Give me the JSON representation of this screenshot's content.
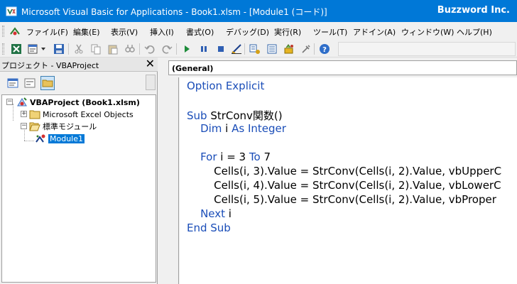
{
  "window": {
    "title": "Microsoft Visual Basic for Applications - Book1.xlsm - [Module1 (コード)]",
    "brand": "Buzzword Inc."
  },
  "menu": {
    "items": [
      {
        "label": "ファイル(F)"
      },
      {
        "label": "編集(E)"
      },
      {
        "label": "表示(V)"
      },
      {
        "label": "挿入(I)"
      },
      {
        "label": "書式(O)"
      },
      {
        "label": "デバッグ(D)"
      },
      {
        "label": "実行(R)"
      },
      {
        "label": "ツール(T)"
      },
      {
        "label": "アドイン(A)"
      },
      {
        "label": "ウィンドウ(W)"
      },
      {
        "label": "ヘルプ(H)"
      }
    ]
  },
  "toolbar": {
    "icons": [
      "excel-icon",
      "insert-userform-icon",
      "save-icon",
      "cut-icon",
      "copy-icon",
      "paste-icon",
      "find-icon",
      "undo-icon",
      "redo-icon",
      "run-icon",
      "break-icon",
      "reset-icon",
      "design-mode-icon",
      "project-explorer-icon",
      "properties-icon",
      "object-browser-icon",
      "toolbox-icon",
      "help-icon"
    ]
  },
  "project": {
    "title": "プロジェクト - VBAProject",
    "close": "✕",
    "tree": {
      "project": "VBAProject (Book1.xlsm)",
      "excel_objects": "Microsoft Excel Objects",
      "standard_modules": "標準モジュール",
      "module": "Module1"
    }
  },
  "code": {
    "procedure_dropdown": "(General)",
    "lines": [
      {
        "segments": [
          {
            "text": "Option Explicit",
            "kw": true
          }
        ]
      },
      {
        "segments": []
      },
      {
        "segments": [
          {
            "text": "Sub ",
            "kw": true
          },
          {
            "text": "StrConv関数()",
            "kw": false
          }
        ]
      },
      {
        "segments": [
          {
            "text": "    Dim ",
            "kw": true
          },
          {
            "text": "i ",
            "kw": false
          },
          {
            "text": "As Integer",
            "kw": true
          }
        ]
      },
      {
        "segments": []
      },
      {
        "segments": [
          {
            "text": "    For ",
            "kw": true
          },
          {
            "text": "i = 3 ",
            "kw": false
          },
          {
            "text": "To ",
            "kw": true
          },
          {
            "text": "7",
            "kw": false
          }
        ]
      },
      {
        "segments": [
          {
            "text": "        Cells(i, 3).Value = StrConv(Cells(i, 2).Value, vbUpperC",
            "kw": false
          }
        ]
      },
      {
        "segments": [
          {
            "text": "        Cells(i, 4).Value = StrConv(Cells(i, 2).Value, vbLowerC",
            "kw": false
          }
        ]
      },
      {
        "segments": [
          {
            "text": "        Cells(i, 5).Value = StrConv(Cells(i, 2).Value, vbProper",
            "kw": false
          }
        ]
      },
      {
        "segments": [
          {
            "text": "    Next ",
            "kw": true
          },
          {
            "text": "i",
            "kw": false
          }
        ]
      },
      {
        "segments": [
          {
            "text": "End Sub",
            "kw": true
          }
        ]
      }
    ]
  },
  "colors": {
    "titlebar": "#0078d7",
    "keyword": "#1a4db8",
    "selection": "#0078d7"
  }
}
